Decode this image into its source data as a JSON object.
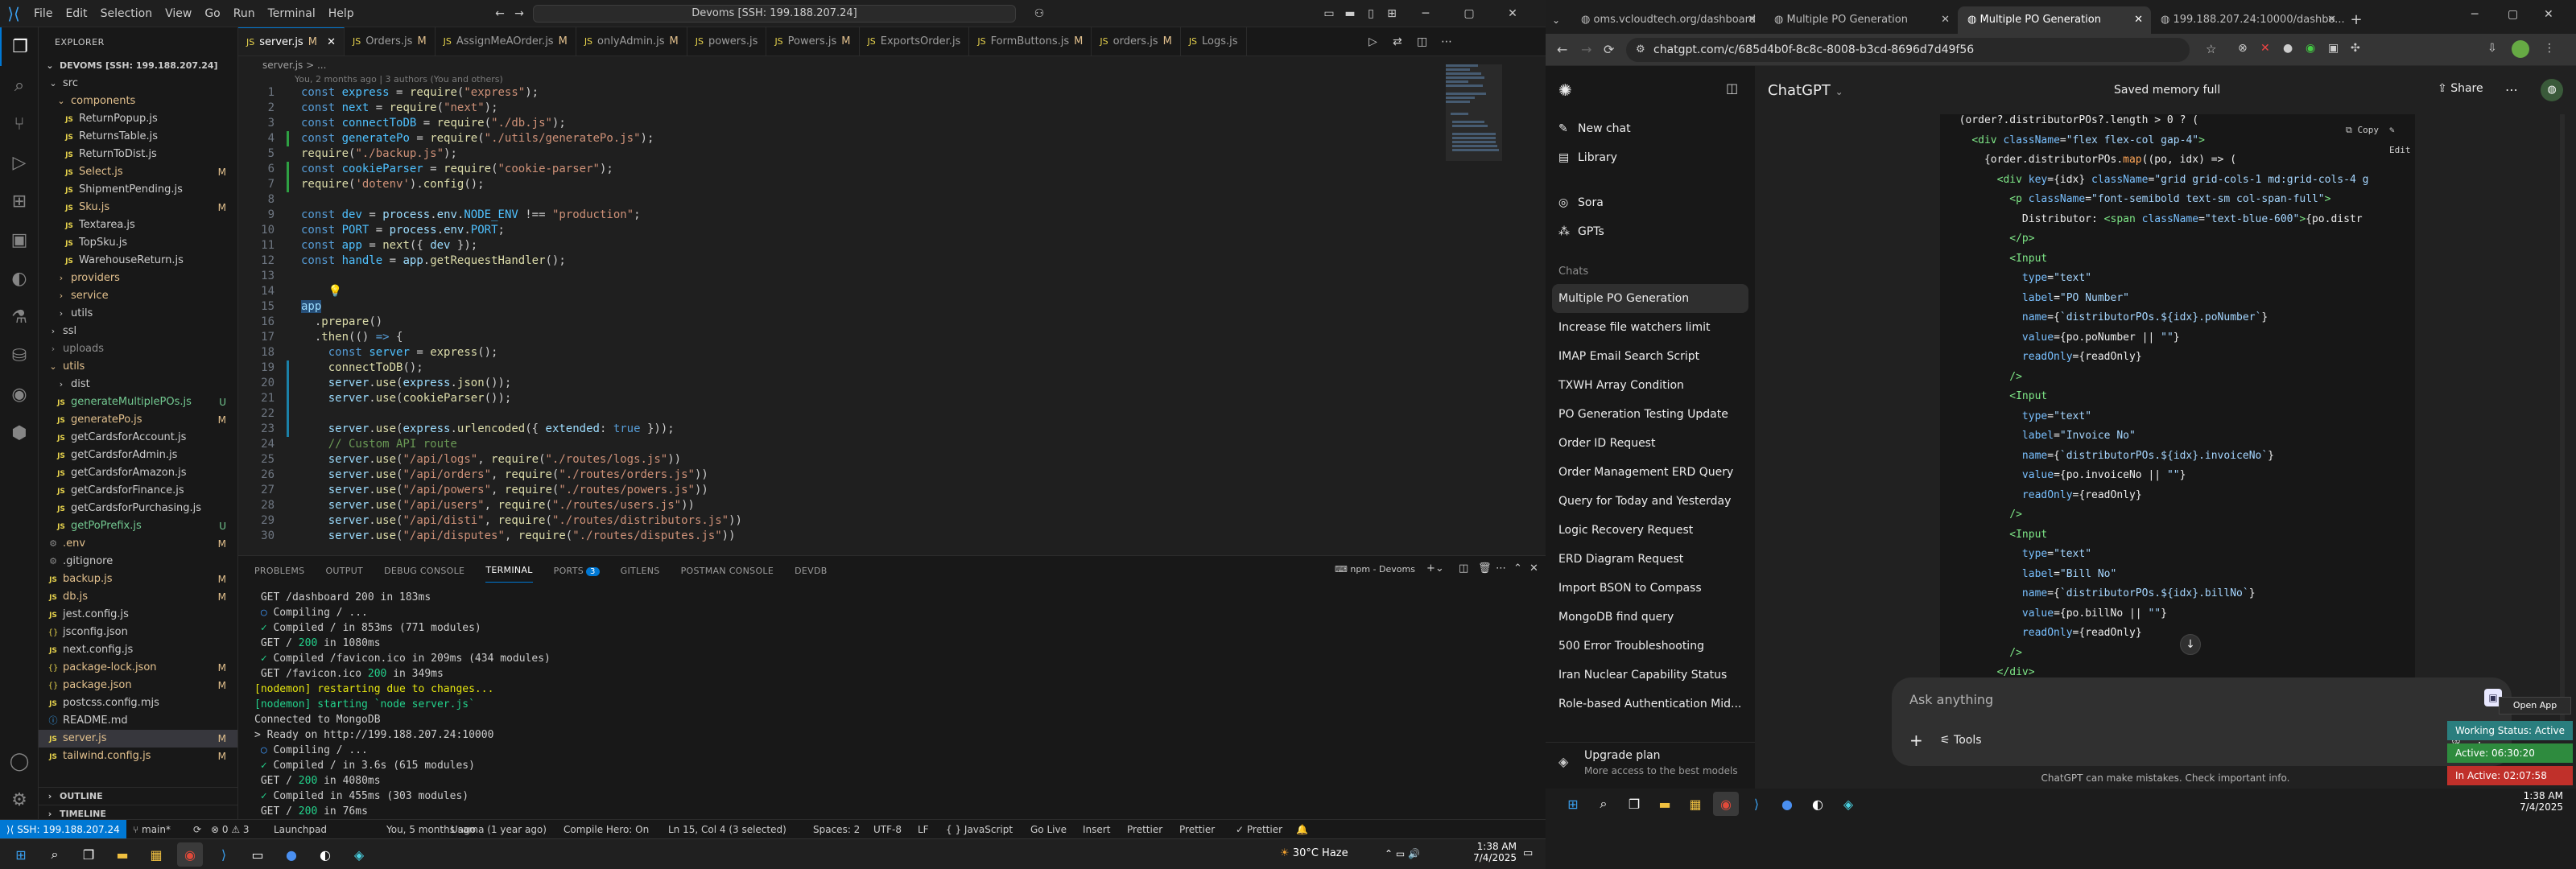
{
  "vscode": {
    "menu": [
      "File",
      "Edit",
      "Selection",
      "View",
      "Go",
      "Run",
      "Terminal",
      "Help"
    ],
    "command_center": "Devoms [SSH: 199.188.207.24]",
    "explorer": {
      "header": "EXPLORER",
      "root": "DEVOMS [SSH: 199.188.207.24]",
      "rows": [
        {
          "label": "src",
          "indent": 1,
          "type": "folder-open",
          "status": "",
          "cls": ""
        },
        {
          "label": "components",
          "indent": 2,
          "type": "folder-open",
          "status": "",
          "cls": "mod"
        },
        {
          "label": "ReturnPopup.js",
          "indent": 3,
          "type": "js",
          "status": "",
          "cls": ""
        },
        {
          "label": "ReturnsTable.js",
          "indent": 3,
          "type": "js",
          "status": "",
          "cls": ""
        },
        {
          "label": "ReturnToDist.js",
          "indent": 3,
          "type": "js",
          "status": "",
          "cls": ""
        },
        {
          "label": "Select.js",
          "indent": 3,
          "type": "js",
          "status": "M",
          "cls": "mod"
        },
        {
          "label": "ShipmentPending.js",
          "indent": 3,
          "type": "js",
          "status": "",
          "cls": ""
        },
        {
          "label": "Sku.js",
          "indent": 3,
          "type": "js",
          "status": "M",
          "cls": "mod"
        },
        {
          "label": "Textarea.js",
          "indent": 3,
          "type": "js",
          "status": "",
          "cls": ""
        },
        {
          "label": "TopSku.js",
          "indent": 3,
          "type": "js",
          "status": "",
          "cls": ""
        },
        {
          "label": "WarehouseReturn.js",
          "indent": 3,
          "type": "js",
          "status": "",
          "cls": ""
        },
        {
          "label": "providers",
          "indent": 2,
          "type": "folder",
          "status": "",
          "cls": "mod"
        },
        {
          "label": "service",
          "indent": 2,
          "type": "folder",
          "status": "",
          "cls": "mod"
        },
        {
          "label": "utils",
          "indent": 2,
          "type": "folder",
          "status": "",
          "cls": ""
        },
        {
          "label": "ssl",
          "indent": 1,
          "type": "folder",
          "status": "",
          "cls": ""
        },
        {
          "label": "uploads",
          "indent": 1,
          "type": "folder",
          "status": "",
          "cls": "ign"
        },
        {
          "label": "utils",
          "indent": 1,
          "type": "folder-open",
          "status": "",
          "cls": "mod"
        },
        {
          "label": "dist",
          "indent": 2,
          "type": "folder",
          "status": "",
          "cls": ""
        },
        {
          "label": "generateMultiplePOs.js",
          "indent": 2,
          "type": "js",
          "status": "U",
          "cls": "unt"
        },
        {
          "label": "generatePo.js",
          "indent": 2,
          "type": "js",
          "status": "M",
          "cls": "mod"
        },
        {
          "label": "getCardsforAccount.js",
          "indent": 2,
          "type": "js",
          "status": "",
          "cls": ""
        },
        {
          "label": "getCardsforAdmin.js",
          "indent": 2,
          "type": "js",
          "status": "",
          "cls": ""
        },
        {
          "label": "getCardsforAmazon.js",
          "indent": 2,
          "type": "js",
          "status": "",
          "cls": ""
        },
        {
          "label": "getCardsforFinance.js",
          "indent": 2,
          "type": "js",
          "status": "",
          "cls": ""
        },
        {
          "label": "getCardsforPurchasing.js",
          "indent": 2,
          "type": "js",
          "status": "",
          "cls": ""
        },
        {
          "label": "getPoPrefix.js",
          "indent": 2,
          "type": "js",
          "status": "U",
          "cls": "unt"
        },
        {
          "label": ".env",
          "indent": 1,
          "type": "env",
          "status": "M",
          "cls": "mod"
        },
        {
          "label": ".gitignore",
          "indent": 1,
          "type": "env",
          "status": "",
          "cls": ""
        },
        {
          "label": "backup.js",
          "indent": 1,
          "type": "js",
          "status": "M",
          "cls": "mod"
        },
        {
          "label": "db.js",
          "indent": 1,
          "type": "js",
          "status": "M",
          "cls": "mod"
        },
        {
          "label": "jest.config.js",
          "indent": 1,
          "type": "js",
          "status": "",
          "cls": ""
        },
        {
          "label": "jsconfig.json",
          "indent": 1,
          "type": "json",
          "status": "",
          "cls": ""
        },
        {
          "label": "next.config.js",
          "indent": 1,
          "type": "js",
          "status": "",
          "cls": ""
        },
        {
          "label": "package-lock.json",
          "indent": 1,
          "type": "json",
          "status": "M",
          "cls": "mod"
        },
        {
          "label": "package.json",
          "indent": 1,
          "type": "json",
          "status": "M",
          "cls": "mod"
        },
        {
          "label": "postcss.config.mjs",
          "indent": 1,
          "type": "js",
          "status": "",
          "cls": ""
        },
        {
          "label": "README.md",
          "indent": 1,
          "type": "md",
          "status": "",
          "cls": ""
        },
        {
          "label": "server.js",
          "indent": 1,
          "type": "js",
          "status": "M",
          "cls": "mod sel"
        },
        {
          "label": "tailwind.config.js",
          "indent": 1,
          "type": "js",
          "status": "M",
          "cls": "mod"
        }
      ],
      "outline": "OUTLINE",
      "timeline": "TIMELINE"
    },
    "tabs": [
      {
        "label": "server.js",
        "mark": "M",
        "active": true
      },
      {
        "label": "Orders.js",
        "mark": "M",
        "active": false
      },
      {
        "label": "AssignMeAOrder.js",
        "mark": "M",
        "active": false
      },
      {
        "label": "onlyAdmin.js",
        "mark": "M",
        "active": false
      },
      {
        "label": "powers.js",
        "mark": "",
        "active": false
      },
      {
        "label": "Powers.js",
        "mark": "M",
        "active": false
      },
      {
        "label": "ExportsOrder.js",
        "mark": "",
        "active": false
      },
      {
        "label": "FormButtons.js",
        "mark": "M",
        "active": false
      },
      {
        "label": "orders.js",
        "mark": "M",
        "active": false
      },
      {
        "label": "Logs.js",
        "mark": "",
        "active": false
      }
    ],
    "breadcrumb": "server.js > ...",
    "blame_header": "You, 2 months ago | 3 authors (You and others)",
    "code": [
      {
        "n": "1",
        "h": "<span class='kw'>const</span> <span class='cn'>express</span> = <span class='fn'>require</span>(<span class='str'>\"express\"</span>);"
      },
      {
        "n": "2",
        "h": "<span class='kw'>const</span> <span class='cn'>next</span> = <span class='fn'>require</span>(<span class='str'>\"next\"</span>);"
      },
      {
        "n": "3",
        "h": "<span class='kw'>const</span> <span class='cn'>connectToDB</span> = <span class='fn'>require</span>(<span class='str'>\"./db.js\"</span>);"
      },
      {
        "n": "4",
        "h": "<span class='kw'>const</span> <span class='cn'>generatePo</span> = <span class='fn'>require</span>(<span class='str'>\"./utils/generatePo.js\"</span>);"
      },
      {
        "n": "5",
        "h": "<span class='fn'>require</span>(<span class='str'>\"./backup.js\"</span>);"
      },
      {
        "n": "6",
        "h": "<span class='kw'>const</span> <span class='cn'>cookieParser</span> = <span class='fn'>require</span>(<span class='str'>\"cookie-parser\"</span>);"
      },
      {
        "n": "7",
        "h": "<span class='fn'>require</span>(<span class='str'>'dotenv'</span>).<span class='fn'>config</span>();"
      },
      {
        "n": "8",
        "h": ""
      },
      {
        "n": "9",
        "h": "<span class='kw'>const</span> <span class='cn'>dev</span> = <span class='var'>process</span>.<span class='var'>env</span>.<span class='cn'>NODE_ENV</span> !== <span class='str'>\"production\"</span>;"
      },
      {
        "n": "10",
        "h": "<span class='kw'>const</span> <span class='cn'>PORT</span> = <span class='var'>process</span>.<span class='var'>env</span>.<span class='cn'>PORT</span>;"
      },
      {
        "n": "11",
        "h": "<span class='kw'>const</span> <span class='cn'>app</span> = <span class='fn'>next</span>({ <span class='var'>dev</span> });"
      },
      {
        "n": "12",
        "h": "<span class='kw'>const</span> <span class='cn'>handle</span> = <span class='var'>app</span>.<span class='fn'>getRequestHandler</span>();"
      },
      {
        "n": "13",
        "h": ""
      },
      {
        "n": "14",
        "h": "    <span class='yel'>💡</span>"
      },
      {
        "n": "15",
        "h": "<span class='var' style='background:#264f78'>app</span>"
      },
      {
        "n": "16",
        "h": "  .<span class='fn'>prepare</span>()"
      },
      {
        "n": "17",
        "h": "  .<span class='fn'>then</span>(() <span class='kw'>=&gt;</span> {"
      },
      {
        "n": "18",
        "h": "    <span class='kw'>const</span> <span class='cn'>server</span> = <span class='fn'>express</span>();"
      },
      {
        "n": "19",
        "h": "    <span class='fn'>connectToDB</span>();"
      },
      {
        "n": "20",
        "h": "    <span class='var'>server</span>.<span class='fn'>use</span>(<span class='var'>express</span>.<span class='fn'>json</span>());"
      },
      {
        "n": "21",
        "h": "    <span class='var'>server</span>.<span class='fn'>use</span>(<span class='fn'>cookieParser</span>());"
      },
      {
        "n": "22",
        "h": ""
      },
      {
        "n": "23",
        "h": "    <span class='var'>server</span>.<span class='fn'>use</span>(<span class='var'>express</span>.<span class='fn'>urlencoded</span>({ <span class='var'>extended</span>: <span class='kw'>true</span> }));"
      },
      {
        "n": "24",
        "h": "    <span class='cmt'>// Custom API route</span>"
      },
      {
        "n": "25",
        "h": "    <span class='var'>server</span>.<span class='fn'>use</span>(<span class='str'>\"/api/logs\"</span>, <span class='fn'>require</span>(<span class='str'>\"./routes/logs.js\"</span>))"
      },
      {
        "n": "26",
        "h": "    <span class='var'>server</span>.<span class='fn'>use</span>(<span class='str'>\"/api/orders\"</span>, <span class='fn'>require</span>(<span class='str'>\"./routes/orders.js\"</span>))"
      },
      {
        "n": "27",
        "h": "    <span class='var'>server</span>.<span class='fn'>use</span>(<span class='str'>\"/api/powers\"</span>, <span class='fn'>require</span>(<span class='str'>\"./routes/powers.js\"</span>))"
      },
      {
        "n": "28",
        "h": "    <span class='var'>server</span>.<span class='fn'>use</span>(<span class='str'>\"/api/users\"</span>, <span class='fn'>require</span>(<span class='str'>\"./routes/users.js\"</span>))"
      },
      {
        "n": "29",
        "h": "    <span class='var'>server</span>.<span class='fn'>use</span>(<span class='str'>\"/api/disti\"</span>, <span class='fn'>require</span>(<span class='str'>\"./routes/distributors.js\"</span>))"
      },
      {
        "n": "30",
        "h": "    <span class='var'>server</span>.<span class='fn'>use</span>(<span class='str'>\"/api/disputes\"</span>, <span class='fn'>require</span>(<span class='str'>\"./routes/disputes.js\"</span>))"
      }
    ],
    "panel_tabs": [
      "PROBLEMS",
      "OUTPUT",
      "DEBUG CONSOLE",
      "TERMINAL",
      "PORTS",
      "GITLENS",
      "POSTMAN CONSOLE",
      "DEVDB"
    ],
    "ports_badge": "3",
    "terminal_label": "npm - Devoms",
    "terminal": [
      {
        "h": " GET /dashboard 200 in 183ms"
      },
      {
        "h": " <span class='blue'>○</span> Compiling / ..."
      },
      {
        "h": " <span class='green'>✓</span> Compiled / in 853ms (771 modules)"
      },
      {
        "h": " GET / <span class='green'>200</span> in 1080ms"
      },
      {
        "h": " <span class='green'>✓</span> Compiled /favicon.ico in 209ms (434 modules)"
      },
      {
        "h": " GET /favicon.ico <span class='green'>200</span> in 349ms"
      },
      {
        "h": "<span class='yel'>[nodemon] restarting due to changes...</span>"
      },
      {
        "h": "<span class='green'>[nodemon] starting `node server.js`</span>"
      },
      {
        "h": "Connected to MongoDB"
      },
      {
        "h": "&gt; Ready on http://199.188.207.24:10000"
      },
      {
        "h": " <span class='blue'>○</span> Compiling / ..."
      },
      {
        "h": " <span class='green'>✓</span> Compiled / in 3.6s (615 modules)"
      },
      {
        "h": " GET / <span class='green'>200</span> in 4080ms"
      },
      {
        "h": " <span class='green'>✓</span> Compiled in 455ms (303 modules)"
      },
      {
        "h": " GET / <span class='green'>200</span> in 76ms"
      },
      {
        "h": "▯"
      }
    ],
    "status": {
      "remote": "SSH: 199.188.207.24",
      "branch": "main*",
      "errors": "⊗ 0 ⚠ 3",
      "launchpad": "Launchpad",
      "blame": "You, 5 months ago",
      "usama": "Usama (1 year ago)",
      "compile": "Compile Hero: On",
      "position": "Ln 15, Col 4 (3 selected)",
      "spaces": "Spaces: 2",
      "encoding": "UTF-8",
      "eol": "LF",
      "lang": "{ } JavaScript",
      "golive": "Go Live",
      "insert": "Insert",
      "prettier1": "Prettier",
      "prettier2": "Prettier",
      "prettier3": "✓ Prettier"
    },
    "taskbar": {
      "weather": "30°C  Haze",
      "time": "1:38 AM",
      "date": "7/4/2025"
    }
  },
  "chrome": {
    "tabs": [
      {
        "label": "oms.vcloudtech.org/dashboard",
        "active": false
      },
      {
        "label": "Multiple PO Generation",
        "active": false
      },
      {
        "label": "Multiple PO Generation",
        "active": true
      },
      {
        "label": "199.188.207.24:10000/dashbo...",
        "active": false
      }
    ],
    "url": "chatgpt.com/c/685d4b0f-8c8c-8008-b3cd-8696d7d49f56",
    "sidebar": {
      "new_chat": "New chat",
      "library": "Library",
      "sora": "Sora",
      "gpts": "GPTs",
      "chats_label": "Chats",
      "history": [
        "Multiple PO Generation",
        "Increase file watchers limit",
        "IMAP Email Search Script",
        "TXWH Array Condition",
        "PO Generation Testing Update",
        "Order ID Request",
        "Order Management ERD Query",
        "Query for Today and Yesterday",
        "Logic Recovery Request",
        "ERD Diagram Request",
        "Import BSON to Compass",
        "MongoDB find query",
        "500 Error Troubleshooting",
        "Iran Nuclear Capability Status",
        "Role-based Authentication Mid..."
      ],
      "upgrade_title": "Upgrade plan",
      "upgrade_sub": "More access to the best models"
    },
    "header": {
      "model": "ChatGPT",
      "memory": "Saved memory full",
      "share": "Share"
    },
    "code_actions": {
      "copy": "Copy",
      "edit": "Edit"
    },
    "code": [
      {
        "h": "  (order?.distributorPOs?.length &gt; 0 ? ("
      },
      {
        "h": "    <span class='tag'>&lt;div</span> <span class='attr'>className</span>=<span class='aval'>\"flex flex-col gap-4\"</span><span class='tag'>&gt;</span>"
      },
      {
        "h": "      {order.distributorPOs.<span class='jsx'>map</span>((po, idx) =&gt; ("
      },
      {
        "h": "        <span class='tag'>&lt;div</span> <span class='attr'>key</span>={idx} <span class='attr'>className</span>=<span class='aval'>\"grid grid-cols-1 md:grid-cols-4 g</span>"
      },
      {
        "h": "          <span class='tag'>&lt;p</span> <span class='attr'>className</span>=<span class='aval'>\"font-semibold text-sm col-span-full\"</span><span class='tag'>&gt;</span>"
      },
      {
        "h": "            Distributor: <span class='tag'>&lt;span</span> <span class='attr'>className</span>=<span class='aval'>\"text-blue-600\"</span><span class='tag'>&gt;</span>{po.distr"
      },
      {
        "h": "          <span class='tag'>&lt;/p&gt;</span>"
      },
      {
        "h": "          <span class='tag'>&lt;Input</span>"
      },
      {
        "h": "            <span class='attr'>type</span>=<span class='aval'>\"text\"</span>"
      },
      {
        "h": "            <span class='attr'>label</span>=<span class='aval'>\"PO Number\"</span>"
      },
      {
        "h": "            <span class='attr'>name</span>={<span class='aval'>`distributorPOs.${idx}.poNumber`</span>}"
      },
      {
        "h": "            <span class='attr'>value</span>={po.poNumber || <span class='aval'>\"\"</span>}"
      },
      {
        "h": "            <span class='attr'>readOnly</span>={readOnly}"
      },
      {
        "h": "          <span class='tag'>/&gt;</span>"
      },
      {
        "h": "          <span class='tag'>&lt;Input</span>"
      },
      {
        "h": "            <span class='attr'>type</span>=<span class='aval'>\"text\"</span>"
      },
      {
        "h": "            <span class='attr'>label</span>=<span class='aval'>\"Invoice No\"</span>"
      },
      {
        "h": "            <span class='attr'>name</span>={<span class='aval'>`distributorPOs.${idx}.invoiceNo`</span>}"
      },
      {
        "h": "            <span class='attr'>value</span>={po.invoiceNo || <span class='aval'>\"\"</span>}"
      },
      {
        "h": "            <span class='attr'>readOnly</span>={readOnly}"
      },
      {
        "h": "          <span class='tag'>/&gt;</span>"
      },
      {
        "h": "          <span class='tag'>&lt;Input</span>"
      },
      {
        "h": "            <span class='attr'>type</span>=<span class='aval'>\"text\"</span>"
      },
      {
        "h": "            <span class='attr'>label</span>=<span class='aval'>\"Bill No\"</span>"
      },
      {
        "h": "            <span class='attr'>name</span>={<span class='aval'>`distributorPOs.${idx}.billNo`</span>}"
      },
      {
        "h": "            <span class='attr'>value</span>={po.billNo || <span class='aval'>\"\"</span>}"
      },
      {
        "h": "            <span class='attr'>readOnly</span>={readOnly}"
      },
      {
        "h": "          <span class='tag'>/&gt;</span>"
      },
      {
        "h": "        <span class='tag'>&lt;/div&gt;</span>"
      },
      {
        "h": "      ))}"
      }
    ],
    "ask_placeholder": "Ask anything",
    "tools": "Tools",
    "disclaimer": "ChatGPT can make mistakes. Check important info.",
    "widget": {
      "open_app": "Open App",
      "working": "Working Status: Active",
      "active": "Active: 06:30:20",
      "inactive": "In Active: 02:07:58"
    },
    "taskbar": {
      "time": "1:38 AM",
      "date": "7/4/2025"
    }
  }
}
